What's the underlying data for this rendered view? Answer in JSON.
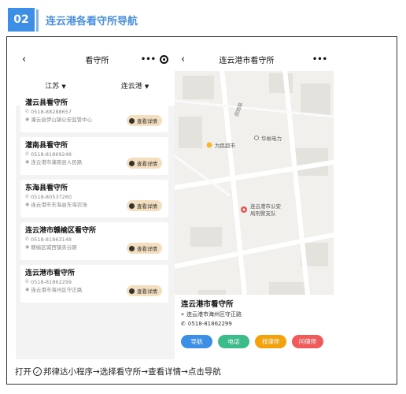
{
  "header": {
    "number": "02",
    "title": "连云港各看守所导航"
  },
  "list_screen": {
    "back_icon": "back-arrow-icon",
    "title": "看守所",
    "more_icon": "more-dots-icon",
    "target_icon": "target-icon",
    "filters": [
      {
        "label": "江苏",
        "icon": "caret-down-icon"
      },
      {
        "label": "连云港",
        "icon": "caret-down-icon"
      }
    ],
    "cards": [
      {
        "name": "灌云县看守所",
        "phone": "0518-88288657",
        "address": "灌云县伊山镇公安监管中心",
        "button": "查看详情"
      },
      {
        "name": "灌南县看守所",
        "phone": "0518-81869248",
        "address": "连云港市灌南县人民路",
        "button": "查看详情"
      },
      {
        "name": "东海县看守所",
        "phone": "0518-80537260",
        "address": "连云港市东海县东海农场",
        "button": "查看详情"
      },
      {
        "name": "连云港市赣榆区看守所",
        "phone": "0518-81863148",
        "address": "赣榆区城西镇夹谷路",
        "button": "查看详情"
      },
      {
        "name": "连云港市看守所",
        "phone": "0518-81862299",
        "address": "连云港市海州区守正路",
        "button": "查看详情"
      }
    ]
  },
  "map_screen": {
    "back_icon": "back-arrow-icon",
    "title": "连云港市看守所",
    "more_icon": "more-dots-icon",
    "map_labels": {
      "road": "团结路",
      "poi_supermarket": "为民超市",
      "poi_power": "华裕电力",
      "marker_line1": "连云港市公安",
      "marker_line2": "局刑警支队"
    },
    "detail": {
      "name": "连云港市看守所",
      "address": "连云港市海州区守正路",
      "phone": "0518-81862299"
    },
    "buttons": [
      {
        "label": "导航",
        "color": "#3d8fe6"
      },
      {
        "label": "电话",
        "color": "#3dbb8a"
      },
      {
        "label": "找律师",
        "color": "#f2a20d"
      },
      {
        "label": "问律师",
        "color": "#ef5a5a"
      }
    ]
  },
  "caption": {
    "prefix": "打开",
    "icon": "app-logo-icon",
    "text": "邦律达小程序→选择看守所→查看详情→点击导航"
  }
}
